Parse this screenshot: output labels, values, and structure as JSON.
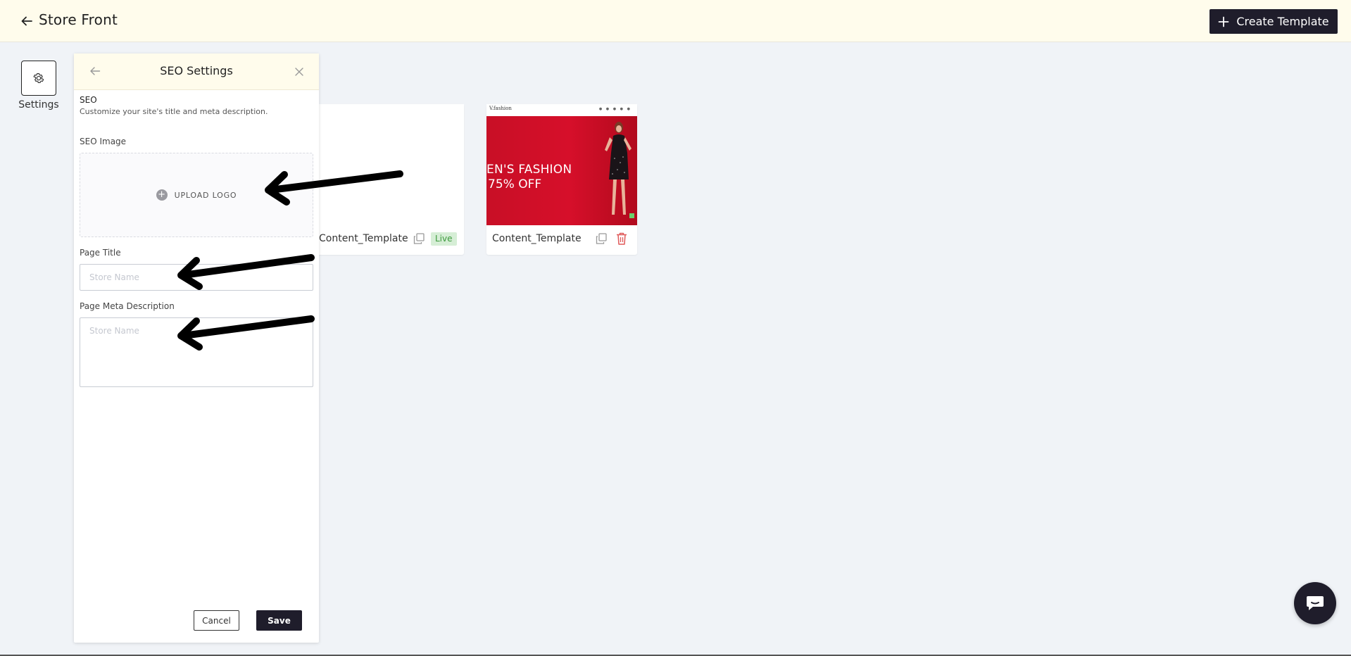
{
  "header": {
    "title": "Store Front",
    "create_label": "Create Template"
  },
  "rail": {
    "settings_label": "Settings"
  },
  "templates": [
    {
      "name": "Content_Template",
      "status": "Live"
    },
    {
      "name": "Content_Template",
      "thumbnail": {
        "logo": "V.fashion",
        "hero_line1": "EN'S FASHION",
        "hero_line2": "75% OFF"
      }
    }
  ],
  "seo_panel": {
    "title": "SEO Settings",
    "section_heading": "SEO",
    "section_description": "Customize your site's title and meta description.",
    "image_label": "SEO Image",
    "upload_label": "UPLOAD LOGO",
    "page_title_label": "Page Title",
    "page_title_placeholder": "Store Name",
    "page_title_value": "",
    "meta_label": "Page Meta Description",
    "meta_placeholder": "Store Name",
    "meta_value": "",
    "cancel_label": "Cancel",
    "save_label": "Save"
  },
  "colors": {
    "header_bg": "#fffcec",
    "primary_dark": "#1f1d2b",
    "page_bg": "#f0f3f7",
    "live_green": "#3c9a3c",
    "delete_red": "#e05a5a",
    "hero_red": "#d60f2a"
  },
  "icons": {
    "back": "arrow-left-icon",
    "plus": "plus-icon",
    "settings": "gear-icon",
    "close": "close-icon",
    "copy": "copy-icon",
    "delete": "trash-icon",
    "chat": "chat-icon",
    "upload": "plus-circle-icon"
  }
}
